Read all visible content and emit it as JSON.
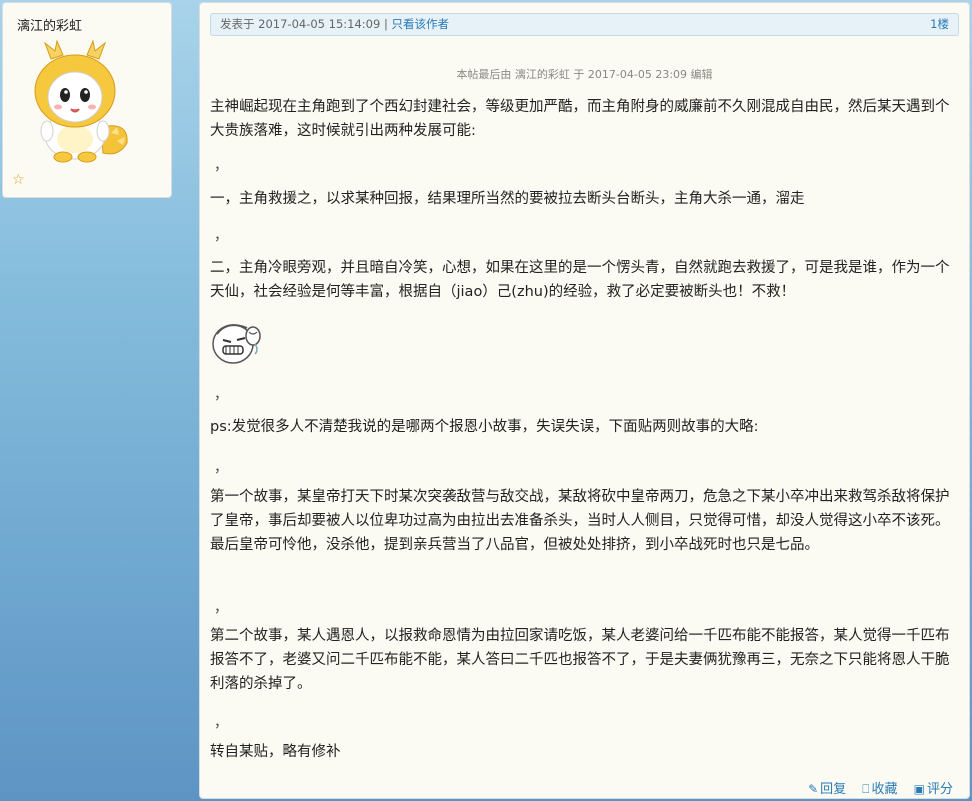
{
  "sidebar": {
    "author_name": "漓江的彩虹",
    "star_icon": "star-outline-icon"
  },
  "post": {
    "posted_label": "发表于 2017-04-05 15:14:09",
    "separator": "|",
    "only_author": "只看该作者",
    "floor": "1楼",
    "edit_note": "本帖最后由 漓江的彩虹 于 2017-04-05 23:09 编辑",
    "comma": "，",
    "paragraphs": [
      "主神崛起现在主角跑到了个西幻封建社会，等级更加严酷，而主角附身的威廉前不久刚混成自由民，然后某天遇到个大贵族落难，这时候就引出两种发展可能:",
      "一，主角救援之，以求某种回报，结果理所当然的要被拉去断头台断头，主角大杀一通，溜走",
      "二，主角冷眼旁观，并且暗自冷笑，心想，如果在这里的是一个愣头青，自然就跑去救援了，可是我是谁，作为一个天仙，社会经验是何等丰富，根据自（jiao）己(zhu)的经验，救了必定要被断头也！不救！",
      "ps:发觉很多人不清楚我说的是哪两个报恩小故事，失误失误，下面贴两则故事的大略:",
      "第一个故事，某皇帝打天下时某次突袭敌营与敌交战，某敌将砍中皇帝两刀，危急之下某小卒冲出来救驾杀敌将保护了皇帝，事后却要被人以位卑功过高为由拉出去准备杀头，当时人人侧目，只觉得可惜，却没人觉得这小卒不该死。最后皇帝可怜他，没杀他，提到亲兵营当了八品官，但被处处排挤，到小卒战死时也只是七品。",
      "第二个故事，某人遇恩人，以报救命恩情为由拉回家请吃饭，某人老婆问给一千匹布能不能报答，某人觉得一千匹布报答不了，老婆又问二千匹布能不能，某人答曰二千匹也报答不了，于是夫妻俩犹豫再三，无奈之下只能将恩人干脆利落的杀掉了。",
      "转自某贴，略有修补"
    ],
    "actions": {
      "reply": "回复",
      "favorite": "收藏",
      "rate": "评分"
    }
  }
}
